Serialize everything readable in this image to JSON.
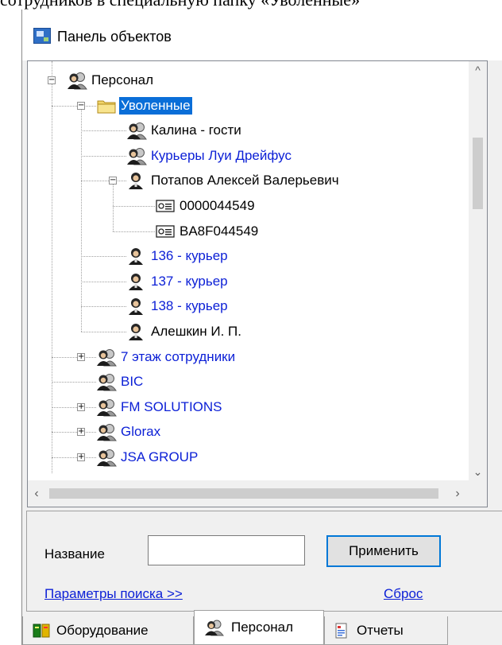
{
  "top_text": "сотрудников в специальную папку «Уволенные»",
  "window": {
    "title": "Панель объектов"
  },
  "tree": {
    "items": [
      {
        "label": "Персонал",
        "color": "black",
        "icon": "group-icon"
      },
      {
        "label": "Уволенные",
        "color": "selected",
        "icon": "folder-icon"
      },
      {
        "label": "Калина - гости",
        "color": "black",
        "icon": "group-icon"
      },
      {
        "label": "Курьеры Луи Дрейфус",
        "color": "blue",
        "icon": "group-icon"
      },
      {
        "label": "Потапов Алексей Валерьевич",
        "color": "black",
        "icon": "person-icon"
      },
      {
        "label": "0000044549",
        "color": "black",
        "icon": "card-icon"
      },
      {
        "label": "BA8F044549",
        "color": "black",
        "icon": "card-icon"
      },
      {
        "label": "136 - курьер",
        "color": "blue",
        "icon": "person-icon"
      },
      {
        "label": "137 - курьер",
        "color": "blue",
        "icon": "person-icon"
      },
      {
        "label": "138 - курьер",
        "color": "blue",
        "icon": "person-icon"
      },
      {
        "label": "Алешкин И. П.",
        "color": "black",
        "icon": "person-icon"
      },
      {
        "label": "7 этаж сотрудники",
        "color": "blue",
        "icon": "group-icon"
      },
      {
        "label": "BIC",
        "color": "blue",
        "icon": "group-icon"
      },
      {
        "label": "FM SOLUTIONS",
        "color": "blue",
        "icon": "group-icon"
      },
      {
        "label": "Glorax",
        "color": "blue",
        "icon": "group-icon"
      },
      {
        "label": "JSA GROUP",
        "color": "blue",
        "icon": "group-icon"
      }
    ]
  },
  "search": {
    "label": "Название",
    "value": "",
    "apply_label": "Применить",
    "params_link": "Параметры поиска >>",
    "reset_link": "Сброс"
  },
  "tabs": [
    {
      "label": "Оборудование",
      "icon": "equipment-icon"
    },
    {
      "label": "Персонал",
      "icon": "group-icon",
      "active": true
    },
    {
      "label": "Отчеты",
      "icon": "report-icon"
    }
  ],
  "colors": {
    "link": "#0b1fd6",
    "selection": "#0a6ed8",
    "focus_border": "#0078d7"
  }
}
